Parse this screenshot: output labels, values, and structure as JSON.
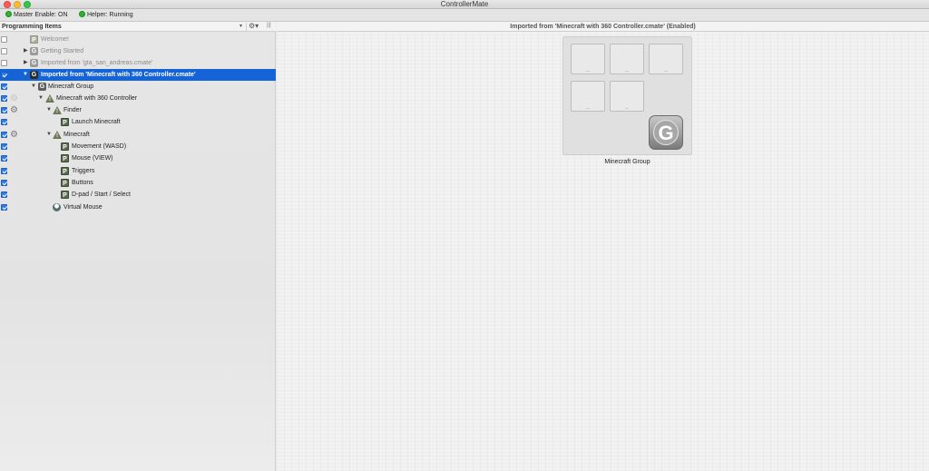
{
  "window": {
    "title": "ControllerMate"
  },
  "status": {
    "master": "Master Enable: ON",
    "helper": "Helper: Running"
  },
  "sidebar": {
    "header": "Programming Items",
    "rows": [
      {
        "label": "Welcome!",
        "checked": false,
        "icon": "P"
      },
      {
        "label": "Getting Started",
        "checked": false,
        "icon": "G"
      },
      {
        "label": "Imported from 'gta_san_andreas.cmate'",
        "checked": false,
        "icon": "G"
      },
      {
        "label": "Imported from 'Minecraft with 360 Controller.cmate'",
        "checked": true,
        "icon": "G",
        "selected": true
      },
      {
        "label": "Minecraft Group",
        "checked": true,
        "icon": "G"
      },
      {
        "label": "Minecraft with 360 Controller",
        "checked": true,
        "icon": "warning"
      },
      {
        "label": "Finder",
        "checked": true,
        "icon": "warning"
      },
      {
        "label": "Launch Minecraft",
        "checked": true,
        "icon": "P"
      },
      {
        "label": "Minecraft",
        "checked": true,
        "icon": "warning"
      },
      {
        "label": "Movement (WASD)",
        "checked": true,
        "icon": "P"
      },
      {
        "label": "Mouse (VIEW)",
        "checked": true,
        "icon": "P"
      },
      {
        "label": "Triggers",
        "checked": true,
        "icon": "P"
      },
      {
        "label": "Buttons",
        "checked": true,
        "icon": "P"
      },
      {
        "label": "D-pad / Start / Select",
        "checked": true,
        "icon": "P"
      },
      {
        "label": "Virtual Mouse",
        "checked": true,
        "icon": "V"
      }
    ]
  },
  "main": {
    "header": "Imported from 'Minecraft with 360 Controller.cmate'  (Enabled)",
    "group_card": {
      "label": "Minecraft Group",
      "icon_letter": "G"
    }
  },
  "colors": {
    "selection": "#1464d8",
    "status_ok": "#2fb52f"
  }
}
